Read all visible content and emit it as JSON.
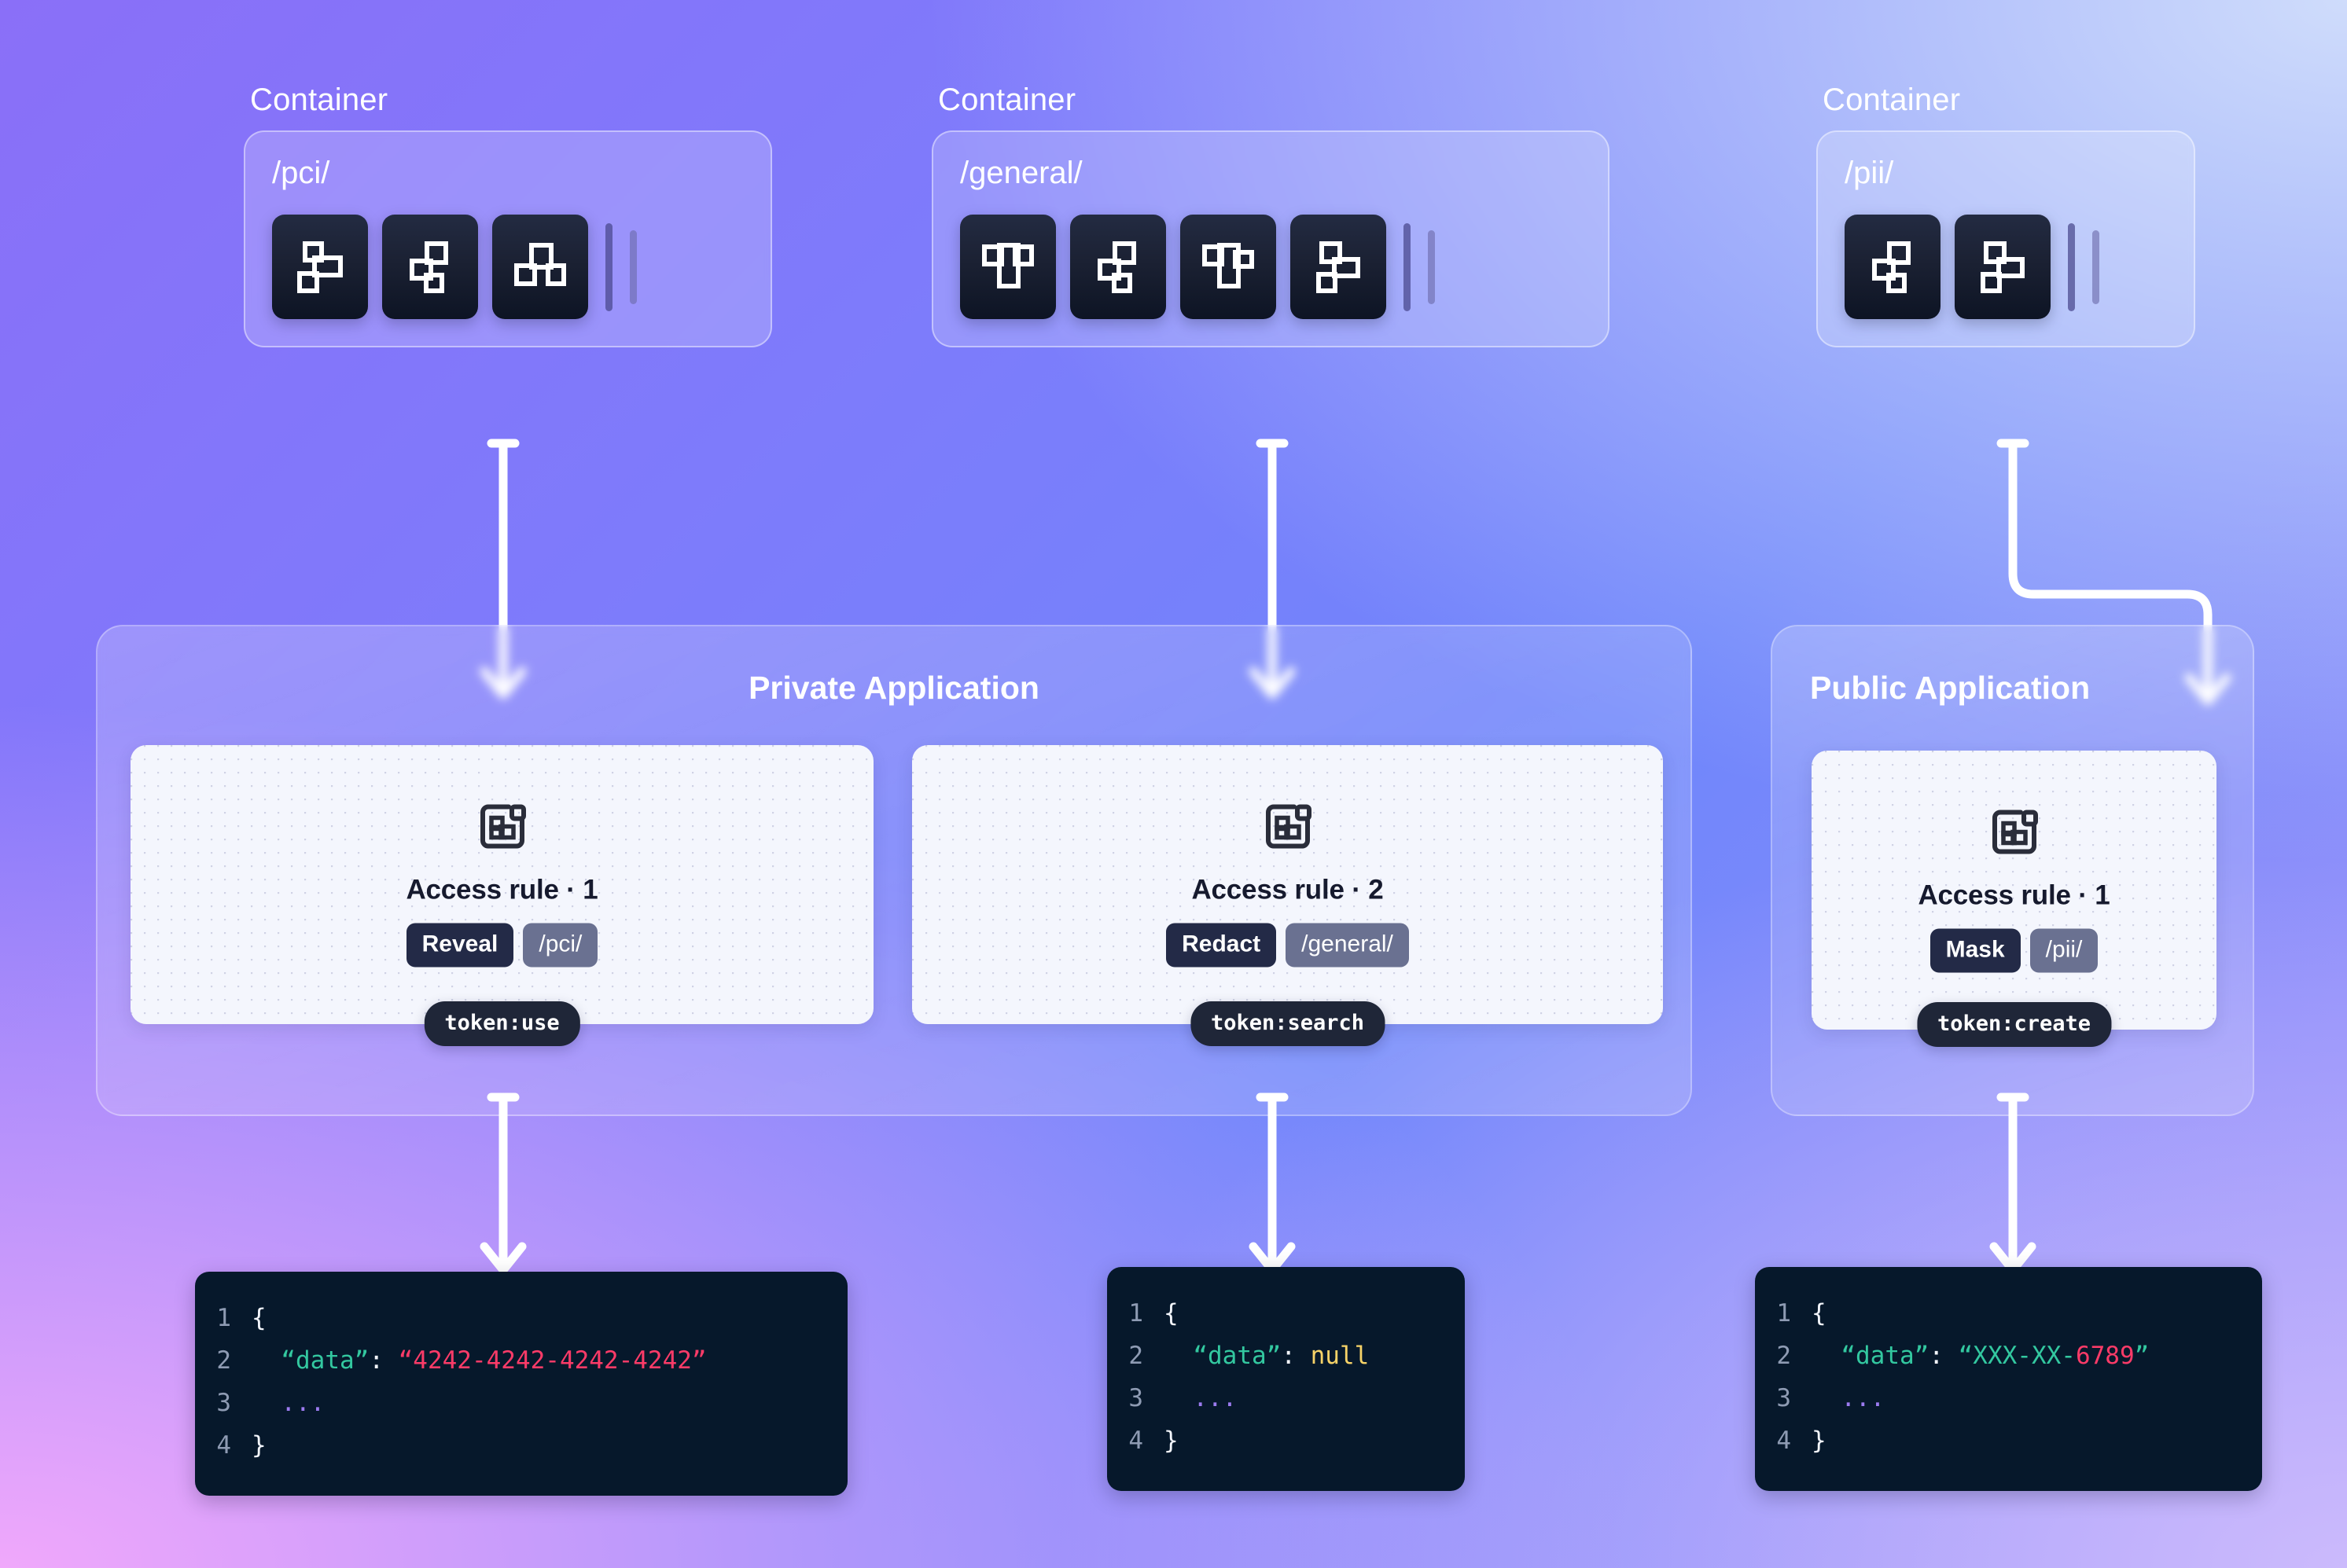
{
  "containers": [
    {
      "caption": "Container",
      "path": "/pci/",
      "tiles": [
        "block-icon-s",
        "block-icon-z",
        "block-icon-t-up",
        "stack-edge-1",
        "stack-edge-2"
      ],
      "tile_count": 3
    },
    {
      "caption": "Container",
      "path": "/general/",
      "tiles": [
        "block-icon-t-down",
        "block-icon-s",
        "block-icon-t-down-2",
        "block-icon-z2"
      ],
      "tile_count": 4
    },
    {
      "caption": "Container",
      "path": "/pii/",
      "tiles": [
        "block-icon-z",
        "block-icon-s"
      ],
      "tile_count": 2
    }
  ],
  "applications": [
    {
      "title": "Private Application",
      "rules": [
        {
          "icon": "access-rule-icon",
          "name": "Access rule · 1",
          "action": "Reveal",
          "scope": "/pci/",
          "token": "token:use"
        },
        {
          "icon": "access-rule-icon",
          "name": "Access rule · 2",
          "action": "Redact",
          "scope": "/general/",
          "token": "token:search"
        }
      ]
    },
    {
      "title": "Public  Application",
      "rules": [
        {
          "icon": "access-rule-icon",
          "name": "Access rule · 1",
          "action": "Mask",
          "scope": "/pii/",
          "token": "token:create"
        }
      ]
    }
  ],
  "outputs": [
    {
      "lines": [
        {
          "no": "1",
          "parts": [
            {
              "t": "{",
              "c": "punc"
            }
          ]
        },
        {
          "no": "2",
          "parts": [
            {
              "t": "  “data”",
              "c": "key"
            },
            {
              "t": ": ",
              "c": "colon"
            },
            {
              "t": "“4242-4242-4242-4242”",
              "c": "str"
            }
          ]
        },
        {
          "no": "3",
          "parts": [
            {
              "t": "  ...",
              "c": "dots"
            }
          ]
        },
        {
          "no": "4",
          "parts": [
            {
              "t": "}",
              "c": "punc"
            }
          ]
        }
      ]
    },
    {
      "lines": [
        {
          "no": "1",
          "parts": [
            {
              "t": "{",
              "c": "punc"
            }
          ]
        },
        {
          "no": "2",
          "parts": [
            {
              "t": "  “data”",
              "c": "key"
            },
            {
              "t": ": ",
              "c": "colon"
            },
            {
              "t": "null",
              "c": "null"
            }
          ]
        },
        {
          "no": "3",
          "parts": [
            {
              "t": "  ...",
              "c": "dots"
            }
          ]
        },
        {
          "no": "4",
          "parts": [
            {
              "t": "}",
              "c": "punc"
            }
          ]
        }
      ]
    },
    {
      "lines": [
        {
          "no": "1",
          "parts": [
            {
              "t": "{",
              "c": "punc"
            }
          ]
        },
        {
          "no": "2",
          "parts": [
            {
              "t": "  “data”",
              "c": "key"
            },
            {
              "t": ": ",
              "c": "colon"
            },
            {
              "t": "“XXX-XX-",
              "c": "teal"
            },
            {
              "t": "6789",
              "c": "pink"
            },
            {
              "t": "”",
              "c": "teal"
            }
          ]
        },
        {
          "no": "3",
          "parts": [
            {
              "t": "  ...",
              "c": "dots"
            }
          ]
        },
        {
          "no": "4",
          "parts": [
            {
              "t": "}",
              "c": "punc"
            }
          ]
        }
      ]
    }
  ],
  "colors": {
    "background_top_left": "#8a6ff8",
    "background_top_right": "#cfdcfb",
    "background_bottom_left": "#f0a8fb",
    "background_bottom_right": "#cbbafc",
    "tile_dark": "#1b2133",
    "card_light": "#f4f6fd",
    "chip_action": "#232a47",
    "chip_scope": "#6a7191",
    "token_pill": "#1f2638",
    "code_background": "#06182b",
    "code_key": "#33c8a0",
    "code_string": "#fb3b68",
    "code_null": "#f7d368",
    "code_ellipsis": "#9c7bf0",
    "arrow": "#ffffff"
  }
}
